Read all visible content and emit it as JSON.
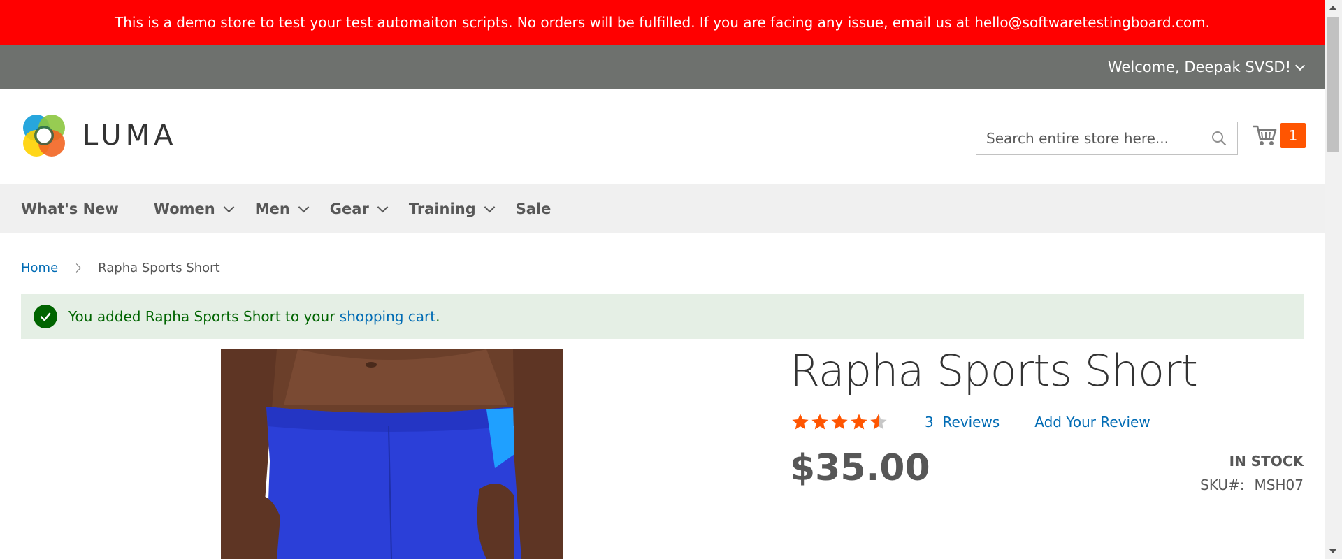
{
  "banner": {
    "text": "This is a demo store to test your test automaiton scripts. No orders will be fulfilled. If you are facing any issue, email us at hello@softwaretestingboard.com."
  },
  "top_panel": {
    "welcome": "Welcome, Deepak SVSD!"
  },
  "header": {
    "logo_text": "LUMA",
    "search_placeholder": "Search entire store here...",
    "cart_count": "1"
  },
  "nav": {
    "items": [
      {
        "label": "What's New",
        "has_dropdown": false
      },
      {
        "label": "Women",
        "has_dropdown": true
      },
      {
        "label": "Men",
        "has_dropdown": true
      },
      {
        "label": "Gear",
        "has_dropdown": true
      },
      {
        "label": "Training",
        "has_dropdown": true
      },
      {
        "label": "Sale",
        "has_dropdown": false
      }
    ]
  },
  "breadcrumb": {
    "home": "Home",
    "current": "Rapha Sports Short"
  },
  "message": {
    "prefix": "You added Rapha Sports Short to your ",
    "link": "shopping cart",
    "suffix": "."
  },
  "product": {
    "title": "Rapha Sports Short",
    "rating_fraction": 0.87,
    "reviews_count": "3",
    "reviews_label": "Reviews",
    "add_review": "Add Your Review",
    "price": "$35.00",
    "stock": "IN STOCK",
    "sku_label": "SKU#:",
    "sku_value": "MSH07"
  },
  "colors": {
    "banner_bg": "#ff0000",
    "top_panel_bg": "#6e716e",
    "accent_orange": "#ff5501",
    "link_blue": "#006bb4",
    "success_bg": "#e5efe5",
    "success_text": "#006400",
    "product_blue": "#2b3fd8"
  }
}
